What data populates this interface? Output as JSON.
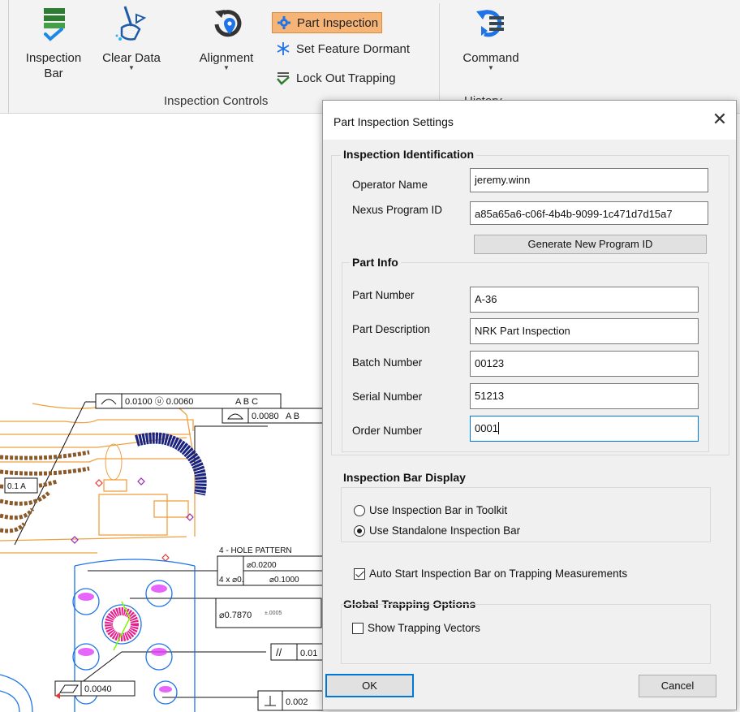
{
  "ribbon": {
    "inspection_controls": {
      "group_label": "Inspection Controls",
      "inspection_bar_label": "Inspection\nBar",
      "clear_data_label": "Clear Data",
      "alignment_label": "Alignment",
      "part_inspection_label": "Part Inspection",
      "set_feature_dormant_label": "Set Feature Dormant",
      "lock_out_trapping_label": "Lock Out Trapping"
    },
    "history": {
      "group_label": "History",
      "command_label": "Command"
    }
  },
  "drawing_annotations": {
    "fcf_profile_1": "0.0100 ⓤ 0.0060",
    "fcf_profile_1_datums": "A B C",
    "fcf_profile_1_tag": "A",
    "fcf_profile_2": "0.0080",
    "fcf_profile_2_datums": "A B",
    "hole_pattern": "4 - HOLE PATTERN",
    "hole_dia_1": "⌀0.0200",
    "hole_count": "4 x ⌀0.",
    "hole_dia_2": "⌀0.1000",
    "dia_787": "⌀0.7870",
    "dia_787_suffix": "±.0005",
    "parallel_value": "0.01",
    "flatness_value": "0.0040",
    "perp_value": "0.002",
    "left_fcf": "0.1 A"
  },
  "dialog": {
    "title": "Part Inspection Settings",
    "inspection_identification": {
      "title": "Inspection Identification",
      "operator_name_label": "Operator Name",
      "operator_name_value": "jeremy.winn",
      "nexus_program_id_label": "Nexus Program ID",
      "nexus_program_id_value": "a85a65a6-c06f-4b4b-9099-1c471d7d15a7",
      "generate_button": "Generate New Program ID"
    },
    "part_info": {
      "title": "Part Info",
      "part_number_label": "Part Number",
      "part_number_value": "A-36",
      "part_description_label": "Part Description",
      "part_description_value": "NRK Part Inspection",
      "batch_number_label": "Batch Number",
      "batch_number_value": "00123",
      "serial_number_label": "Serial Number",
      "serial_number_value": "51213",
      "order_number_label": "Order Number",
      "order_number_value": "0001"
    },
    "inspection_bar_display": {
      "title": "Inspection Bar Display",
      "option_toolkit": "Use Inspection Bar in Toolkit",
      "option_standalone": "Use Standalone Inspection Bar",
      "selected": "standalone",
      "auto_start_label": "Auto Start Inspection Bar on Trapping Measurements",
      "auto_start_checked": true
    },
    "global_trapping": {
      "title": "Global Trapping Options",
      "show_vectors_label": "Show Trapping Vectors",
      "show_vectors_checked": false
    },
    "ok_label": "OK",
    "cancel_label": "Cancel"
  },
  "colors": {
    "accent": "#0078d7",
    "active_button": "#f6b577",
    "drawing_blue": "#1e73e8",
    "drawing_orange": "#f0a040",
    "drawing_navy": "#1a237e",
    "drawing_magenta": "#e91e8c",
    "drawing_brown": "#8b5a2b"
  }
}
